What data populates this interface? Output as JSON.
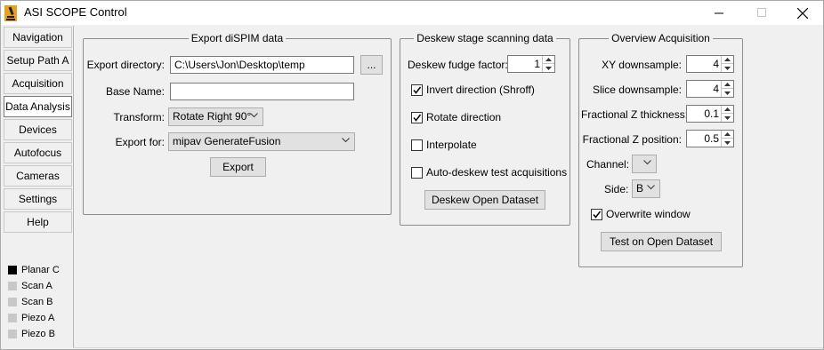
{
  "window": {
    "title": "ASI SCOPE Control"
  },
  "tabs": [
    "Navigation",
    "Setup Path A",
    "Acquisition",
    "Data Analysis",
    "Devices",
    "Autofocus",
    "Cameras",
    "Settings",
    "Help"
  ],
  "active_tab": "Data Analysis",
  "status": [
    {
      "label": "Planar C",
      "color": "#000000"
    },
    {
      "label": "Scan A",
      "color": "#c8c8c8"
    },
    {
      "label": "Scan B",
      "color": "#c8c8c8"
    },
    {
      "label": "Piezo A",
      "color": "#c8c8c8"
    },
    {
      "label": "Piezo B",
      "color": "#c8c8c8"
    }
  ],
  "export_group": {
    "title": "Export diSPIM data",
    "dir_label": "Export directory:",
    "dir_value": "C:\\Users\\Jon\\Desktop\\temp",
    "browse_label": "...",
    "base_label": "Base Name:",
    "base_value": "",
    "transform_label": "Transform:",
    "transform_value": "Rotate Right 90°",
    "exportfor_label": "Export for:",
    "exportfor_value": "mipav GenerateFusion",
    "export_button": "Export"
  },
  "deskew_group": {
    "title": "Deskew stage scanning data",
    "fudge_label": "Deskew fudge factor:",
    "fudge_value": "1",
    "invert_label": "Invert direction (Shroff)",
    "invert_checked": true,
    "rotate_label": "Rotate direction",
    "rotate_checked": true,
    "interpolate_label": "Interpolate",
    "interpolate_checked": false,
    "auto_label": "Auto-deskew test acquisitions",
    "auto_checked": false,
    "open_button": "Deskew Open Dataset"
  },
  "overview_group": {
    "title": "Overview Acquisition",
    "xy_label": "XY downsample:",
    "xy_value": "4",
    "slice_label": "Slice downsample:",
    "slice_value": "4",
    "zthick_label": "Fractional Z thickness:",
    "zthick_value": "0.1",
    "zpos_label": "Fractional Z position:",
    "zpos_value": "0.5",
    "channel_label": "Channel:",
    "channel_value": "",
    "side_label": "Side:",
    "side_value": "B",
    "overwrite_label": "Overwrite window",
    "overwrite_checked": true,
    "test_button": "Test on Open Dataset"
  }
}
